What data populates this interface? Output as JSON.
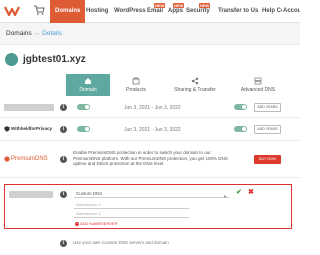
{
  "nav": {
    "items": [
      {
        "label": "Domains",
        "active": true
      },
      {
        "label": "Hosting",
        "active": false
      },
      {
        "label": "WordPress",
        "active": false
      },
      {
        "label": "Email",
        "active": false,
        "badge": "NEW"
      },
      {
        "label": "Apps",
        "active": false,
        "badge": "NEW"
      },
      {
        "label": "Security",
        "active": false,
        "badge": "NEW"
      },
      {
        "label": "Transfer to Us",
        "active": false
      },
      {
        "label": "Help Center",
        "active": false
      },
      {
        "label": "Account",
        "active": false
      }
    ],
    "accent_color": "#de5b33"
  },
  "breadcrumb": {
    "root": "Domains",
    "separator": "→",
    "current": "Details"
  },
  "domain": {
    "name": "jgbtest01.xyz"
  },
  "tabs": [
    {
      "label": "Domain",
      "icon": "home-icon",
      "active": true
    },
    {
      "label": "Products",
      "icon": "box-icon",
      "active": false
    },
    {
      "label": "Sharing & Transfer",
      "icon": "share-icon",
      "active": false
    },
    {
      "label": "Advanced DNS",
      "icon": "dns-icon",
      "active": false
    }
  ],
  "rows": {
    "status": {
      "dates": "Jun 3, 2021 - Jun 3, 2022",
      "action_label": "ADD YEARS",
      "toggle_on": true
    },
    "whoisguard": {
      "brand": "WithheldforPrivacy",
      "dates": "Jun 3, 2021 - Jun 3, 2022",
      "action_label": "ADD YEARS",
      "toggle_on": true
    },
    "premiumdns": {
      "brand": "PremiumDNS",
      "description": "Enable PremiumDNS protection in order to switch your domain to our PremiumDNS platform. With our PremiumDNS protection, you get 100% DNS uptime and DDoS protection at the DNS level.",
      "action_label": "BUY NOW"
    },
    "nameservers": {
      "select_value": "Custom DNS",
      "ns1_placeholder": "Nameserver 1",
      "ns2_placeholder": "Nameserver 2",
      "add_label": "ADD NAMESERVER"
    },
    "bottom": {
      "text": "Use your own Custom DNS servers and domain"
    }
  }
}
